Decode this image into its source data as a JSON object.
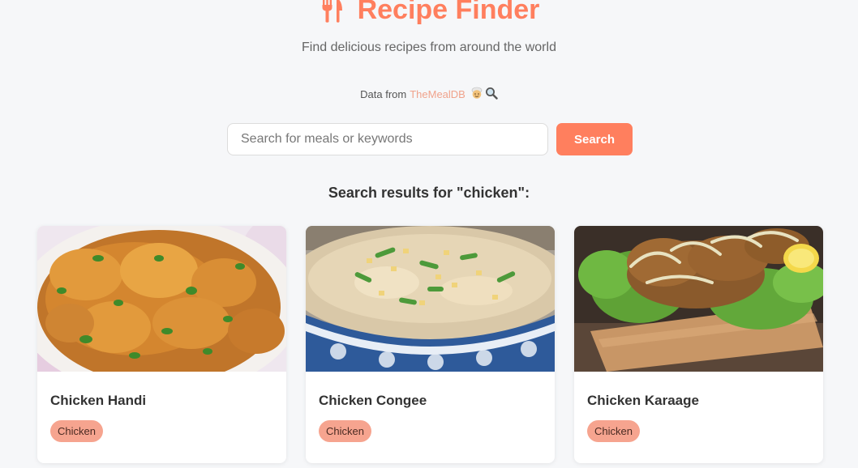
{
  "header": {
    "title": "Recipe Finder",
    "subtitle": "Find delicious recipes from around the world",
    "data_from_prefix": "Data from",
    "data_source_link": "TheMealDB"
  },
  "search": {
    "placeholder": "Search for meals or keywords",
    "value": "",
    "button_label": "Search"
  },
  "results": {
    "heading": "Search results for \"chicken\":",
    "cards": [
      {
        "title": "Chicken Handi",
        "tag": "Chicken"
      },
      {
        "title": "Chicken Congee",
        "tag": "Chicken"
      },
      {
        "title": "Chicken Karaage",
        "tag": "Chicken"
      }
    ]
  },
  "colors": {
    "accent": "#ff7f5e",
    "tag_bg": "#f6a48f",
    "link": "#f0a38c",
    "background": "#f6f7f9"
  },
  "icons": {
    "title_icon": "fork-knife-icon",
    "chef_emoji": "chef-emoji-icon",
    "magnifier_emoji": "magnifier-emoji-icon"
  }
}
